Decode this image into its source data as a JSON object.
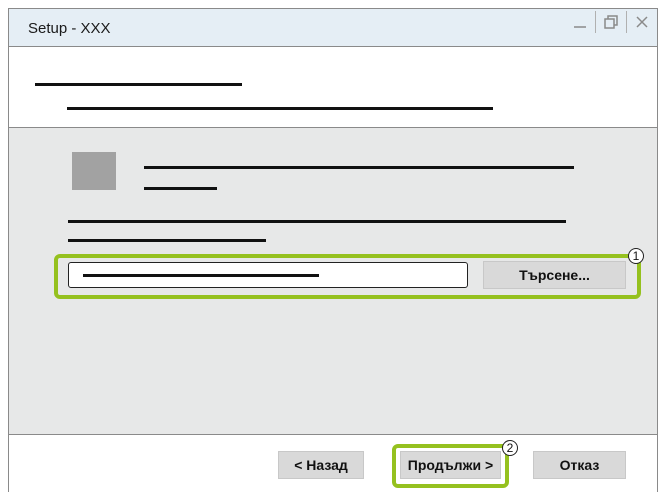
{
  "window": {
    "title": "Setup - XXX",
    "controls": {
      "minimize_icon": "minimize-icon",
      "restore_icon": "restore-icon",
      "close_icon": "close-icon"
    }
  },
  "content": {
    "browse_button": "Търсене...",
    "callout_1": "1"
  },
  "footer": {
    "back_button": "< Назад",
    "next_button": "Продължи >",
    "cancel_button": "Отказ",
    "callout_2": "2"
  },
  "colors": {
    "highlight": "#95c11f",
    "titlebar": "#e5eef5",
    "content_bg": "#e7e8e8",
    "button_bg": "#d9d9d9"
  }
}
